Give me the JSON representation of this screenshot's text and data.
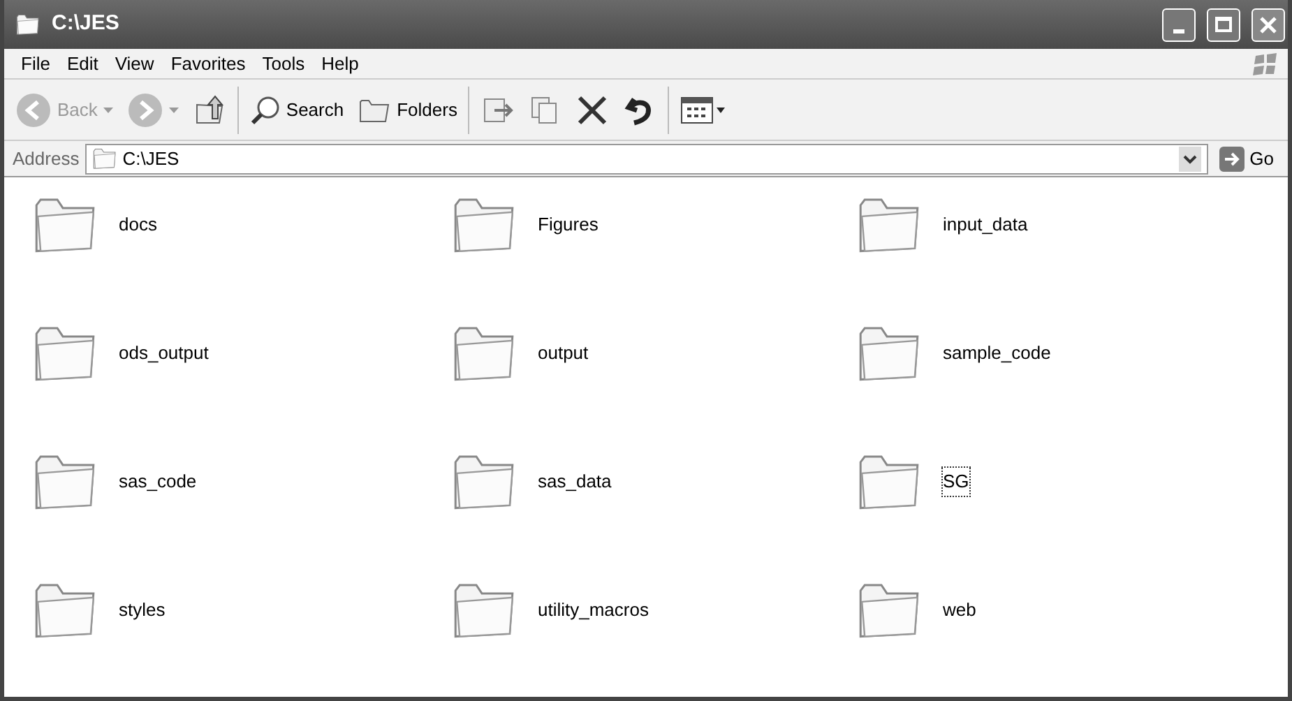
{
  "window": {
    "title": "C:\\JES"
  },
  "menu": [
    "File",
    "Edit",
    "View",
    "Favorites",
    "Tools",
    "Help"
  ],
  "toolbar": [
    {
      "kind": "back",
      "label": "Back"
    },
    {
      "kind": "forward"
    },
    {
      "kind": "up"
    },
    {
      "kind": "search",
      "label": "Search"
    },
    {
      "kind": "folders",
      "label": "Folders"
    },
    {
      "kind": "move"
    },
    {
      "kind": "copy"
    },
    {
      "kind": "delete"
    },
    {
      "kind": "undo"
    },
    {
      "kind": "views"
    }
  ],
  "address": {
    "label": "Address",
    "value": "C:\\JES",
    "go": "Go"
  },
  "items": [
    {
      "name": "docs",
      "focused": false
    },
    {
      "name": "Figures",
      "focused": false
    },
    {
      "name": "input_data",
      "focused": false
    },
    {
      "name": "ods_output",
      "focused": false
    },
    {
      "name": "output",
      "focused": false
    },
    {
      "name": "sample_code",
      "focused": false
    },
    {
      "name": "sas_code",
      "focused": false
    },
    {
      "name": "sas_data",
      "focused": false
    },
    {
      "name": "SG",
      "focused": true
    },
    {
      "name": "styles",
      "focused": false
    },
    {
      "name": "utility_macros",
      "focused": false
    },
    {
      "name": "web",
      "focused": false
    }
  ]
}
